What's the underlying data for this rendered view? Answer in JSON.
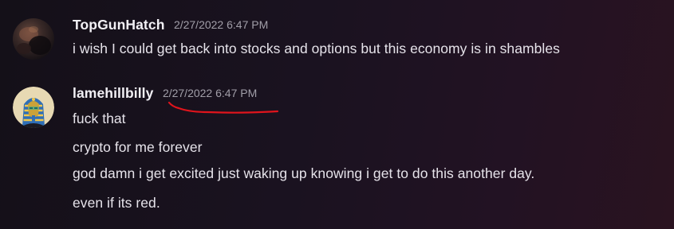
{
  "messages": [
    {
      "username": "TopGunHatch",
      "timestamp": "2/27/2022 6:47 PM",
      "lines": [
        "i wish I could get back into stocks and options but this economy is in shambles"
      ]
    },
    {
      "username": "lamehillbilly",
      "timestamp": "2/27/2022 6:47 PM",
      "lines": [
        "fuck that",
        "crypto for me forever",
        "god damn i get excited just waking up knowing i get to do this another day.",
        "even if its red."
      ]
    }
  ],
  "colors": {
    "background_start": "#141018",
    "background_end": "#2a1320",
    "username": "#f2f0f5",
    "timestamp": "#a19ea8",
    "message_text": "#e6e3ea",
    "annotation_red": "#e0141c"
  },
  "icons": {
    "avatar_1": "user-avatar-dark-photo",
    "avatar_2": "user-avatar-pharaoh"
  }
}
